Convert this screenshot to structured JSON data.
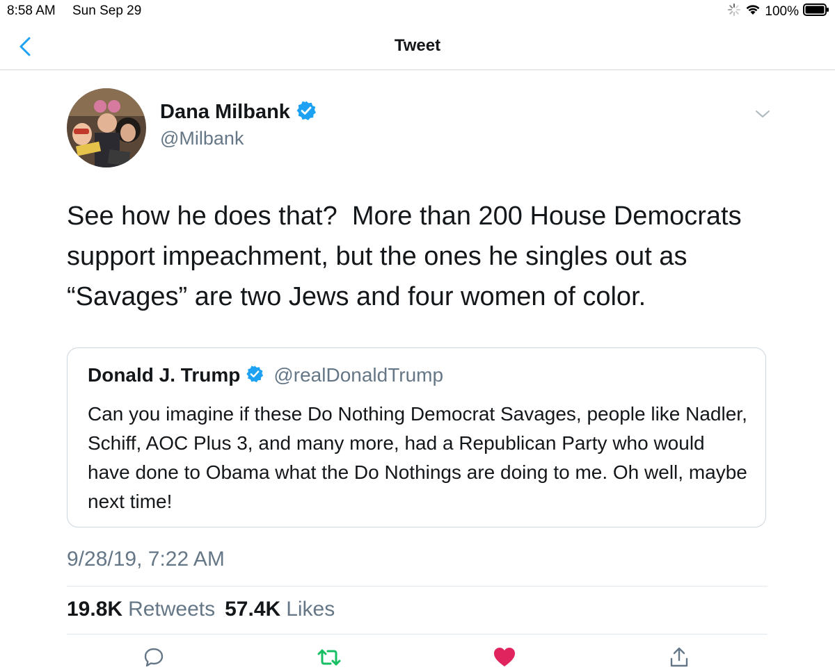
{
  "status_bar": {
    "time": "8:58 AM",
    "date": "Sun Sep 29",
    "battery": "100%",
    "icons": [
      "activity-spinner-icon",
      "wifi-icon",
      "battery-icon"
    ]
  },
  "nav": {
    "title": "Tweet",
    "back_icon": "chevron-left-icon"
  },
  "tweet": {
    "author": {
      "name": "Dana Milbank",
      "handle": "@Milbank",
      "verified": true
    },
    "text": "See how he does that?  More than 200 House Democrats support impeachment, but the ones he singles out as “Savages” are two Jews and four women of color.",
    "quoted_tweet": {
      "name": "Donald J. Trump",
      "handle": "@realDonaldTrump",
      "verified": true,
      "text": "Can you imagine if these Do Nothing Democrat Savages, people like Nadler, Schiff, AOC Plus 3, and many more, had a Republican Party who would have done to Obama what the Do Nothings are doing to me. Oh well, maybe next time!"
    },
    "timestamp": "9/28/19, 7:22 AM",
    "stats": {
      "retweets_count": "19.8K",
      "retweets_label": "Retweets",
      "likes_count": "57.4K",
      "likes_label": "Likes"
    },
    "actions": [
      "reply-icon",
      "retweet-icon",
      "like-icon",
      "share-icon"
    ]
  },
  "colors": {
    "verified_blue": "#1da1f2",
    "retweet_green": "#17bf63",
    "like_red": "#e0245e",
    "muted_gray": "#657786",
    "border_gray": "#ccd6dd",
    "back_blue": "#1da1f2"
  }
}
